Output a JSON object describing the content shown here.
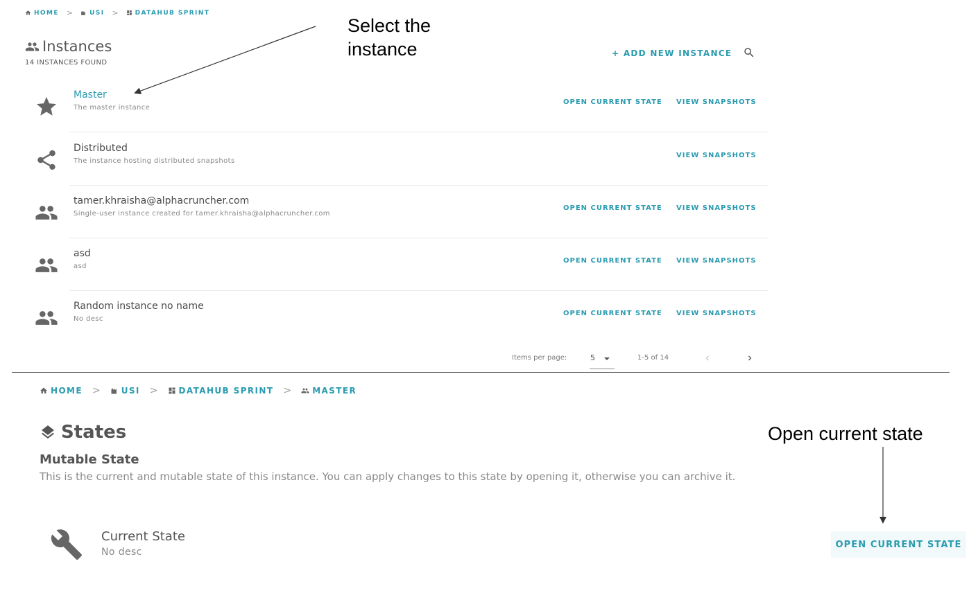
{
  "breadcrumb_top": [
    "HOME",
    "USI",
    "DATAHUB SPRINT"
  ],
  "header": {
    "title": "Instances",
    "count": "14 INSTANCES FOUND",
    "add_label": "+ ADD NEW INSTANCE",
    "search_icon": "search-icon"
  },
  "instances": [
    {
      "name": "Master",
      "desc": "The master instance",
      "icon": "star-icon",
      "open_label": "OPEN CURRENT STATE",
      "snap_label": "VIEW SNAPSHOTS"
    },
    {
      "name": "Distributed",
      "desc": "The instance hosting distributed snapshots",
      "icon": "share-icon",
      "snap_label": "VIEW SNAPSHOTS"
    },
    {
      "name": "tamer.khraisha@alphacruncher.com",
      "desc": "Single-user instance created for tamer.khraisha@alphacruncher.com",
      "icon": "people-icon",
      "open_label": "OPEN CURRENT STATE",
      "snap_label": "VIEW SNAPSHOTS"
    },
    {
      "name": "asd",
      "desc": "asd",
      "icon": "people-icon",
      "open_label": "OPEN CURRENT STATE",
      "snap_label": "VIEW SNAPSHOTS"
    },
    {
      "name": "Random instance no name",
      "desc": "No desc",
      "icon": "people-icon",
      "open_label": "OPEN CURRENT STATE",
      "snap_label": "VIEW SNAPSHOTS"
    }
  ],
  "paginator": {
    "label": "Items per page:",
    "page_size": "5",
    "range": "1-5 of 14"
  },
  "breadcrumb_bottom": [
    "HOME",
    "USI",
    "DATAHUB SPRINT",
    "MASTER"
  ],
  "states": {
    "title": "States",
    "subtitle": "Mutable State",
    "description": "This is the current and mutable state of this instance. You can apply changes to this state by opening it, otherwise you can archive it.",
    "current_name": "Current State",
    "current_desc": "No desc",
    "open_label": "OPEN CURRENT STATE"
  },
  "annotations": {
    "select_line1": "Select the",
    "select_line2": "instance",
    "open": "Open current state"
  },
  "colors": {
    "accent": "#2a9bb0",
    "text": "#4a4a4a",
    "muted": "#888888",
    "icon": "#666666"
  }
}
